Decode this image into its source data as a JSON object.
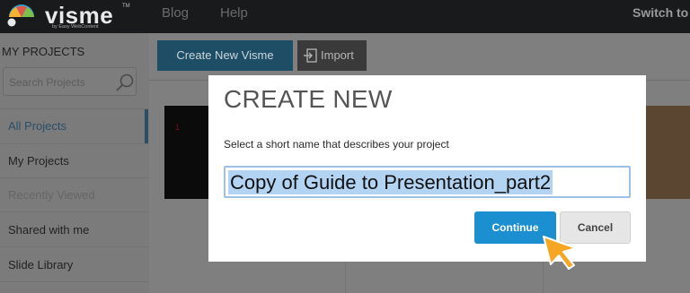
{
  "topbar": {
    "logo": {
      "word": "visme",
      "tm": "TM",
      "sub": "by Easy WebContent"
    },
    "nav": {
      "blog": "Blog",
      "help": "Help",
      "switch": "Switch to V"
    }
  },
  "sidebar": {
    "title": "MY PROJECTS",
    "search": {
      "placeholder": "Search Projects"
    },
    "items": [
      {
        "label": "All Projects",
        "state": "active"
      },
      {
        "label": "My Projects",
        "state": "normal"
      },
      {
        "label": "Recently Viewed",
        "state": "disabled"
      },
      {
        "label": "Shared with me",
        "state": "normal"
      },
      {
        "label": "Slide Library",
        "state": "normal"
      }
    ]
  },
  "main": {
    "create_label": "Create New Visme",
    "import_label": "Import",
    "thumb_number": "1"
  },
  "modal": {
    "title": "CREATE NEW",
    "subtitle": "Select a short name that describes your project",
    "name_value": "Copy of Guide to Presentation_part2",
    "continue_label": "Continue",
    "cancel_label": "Cancel"
  },
  "colors": {
    "continue": "#1c8fd0",
    "create_button": "#1e4e66",
    "cursor": "#f5a623"
  }
}
